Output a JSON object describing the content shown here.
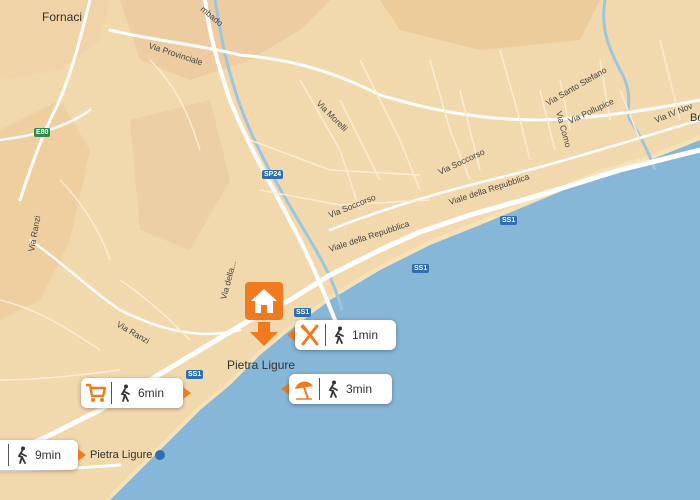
{
  "map": {
    "town_labels": {
      "fornaci": "Fornaci",
      "pietra_ligure_main": "Pietra Ligure",
      "pietra_ligure_station": "Pietra Ligure",
      "partial_right": "Bo"
    },
    "road_labels": {
      "via_provinciale": "Via Provinciale",
      "mbado": "mbado",
      "via_morelli": "Via Morelli",
      "via_santo_stefano": "Via Santo Stefano",
      "via_pollupice": "Via Pollupice",
      "via_iv_nov": "Via IV Nov",
      "via_como": "Via Como",
      "via_soccorso_1": "Via Soccorso",
      "via_soccorso_2": "Via Soccorso",
      "viale_repubblica_1": "Viale della Repubblica",
      "viale_repubblica_2": "Viale della Repubblica",
      "via_ranzi_1": "Via Ranzi",
      "via_ranzi_2": "Via Ranzi",
      "via_partial": "Via della..."
    },
    "shields": {
      "e80": "E80",
      "sp24": "SP24",
      "ss1_a": "SS1",
      "ss1_b": "SS1",
      "ss1_c": "SS1",
      "ss1_d": "SS1"
    },
    "colors": {
      "land": "#f2d8ad",
      "sea": "#87b7d6",
      "accent": "#f07a20",
      "road": "#ffffff"
    }
  },
  "callouts": [
    {
      "icon": "restaurant-icon",
      "walk_icon": "walk-icon",
      "time": "1min"
    },
    {
      "icon": "beach-umbrella-icon",
      "walk_icon": "walk-icon",
      "time": "3min"
    },
    {
      "icon": "shopping-cart-icon",
      "walk_icon": "walk-icon",
      "time": "6min"
    },
    {
      "icon": "train-icon",
      "walk_icon": "walk-icon",
      "time": "9min"
    }
  ],
  "home_marker": {
    "icon": "home-icon"
  }
}
